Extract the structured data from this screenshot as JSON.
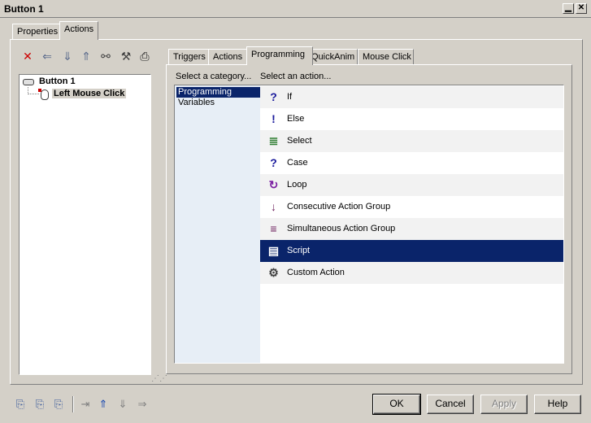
{
  "window": {
    "title": "Button 1"
  },
  "outer_tabs": [
    {
      "label": "Properties"
    },
    {
      "label": "Actions"
    }
  ],
  "left_toolbar": [
    {
      "icon": "delete-icon",
      "glyph": "✕",
      "color": "#cc0000"
    },
    {
      "icon": "arrow-left-icon",
      "glyph": "⇐",
      "color": "#5a6a8c"
    },
    {
      "icon": "arrow-down-icon",
      "glyph": "⇓",
      "color": "#5a6a8c"
    },
    {
      "icon": "arrow-up-icon",
      "glyph": "⇑",
      "color": "#5a6a8c"
    },
    {
      "icon": "find-icon",
      "glyph": "⚯",
      "color": "#404040"
    },
    {
      "icon": "tools-icon",
      "glyph": "⚒",
      "color": "#404040"
    },
    {
      "icon": "print-icon",
      "glyph": "⎙",
      "color": "#202020"
    }
  ],
  "tree": {
    "root": "Button 1",
    "child": "Left Mouse Click"
  },
  "inner_tabs": [
    {
      "label": "Triggers"
    },
    {
      "label": "Actions"
    },
    {
      "label": "Programming"
    },
    {
      "label": "QuickAnim"
    },
    {
      "label": "Mouse Click"
    }
  ],
  "headers": {
    "category": "Select a category...",
    "action": "Select an action..."
  },
  "categories": [
    {
      "label": "Programming",
      "selected": true
    },
    {
      "label": "Variables",
      "selected": false
    }
  ],
  "actions": [
    {
      "label": "If",
      "icon": "question-icon",
      "glyph": "?",
      "color": "#1a1a9c"
    },
    {
      "label": "Else",
      "icon": "exclamation-icon",
      "glyph": "!",
      "color": "#1a1a9c"
    },
    {
      "label": "Select",
      "icon": "select-icon",
      "glyph": "≣",
      "color": "#2e7d32"
    },
    {
      "label": "Case",
      "icon": "case-icon",
      "glyph": "?",
      "color": "#1a1a9c"
    },
    {
      "label": "Loop",
      "icon": "loop-icon",
      "glyph": "↻",
      "color": "#7b1fa2"
    },
    {
      "label": "Consecutive Action Group",
      "icon": "consecutive-group-icon",
      "glyph": "↓",
      "color": "#6a1b5a"
    },
    {
      "label": "Simultaneous Action Group",
      "icon": "simultaneous-group-icon",
      "glyph": "≡",
      "color": "#6a1b5a"
    },
    {
      "label": "Script",
      "icon": "script-icon",
      "glyph": "▤",
      "color": "#ffffff"
    },
    {
      "label": "Custom Action",
      "icon": "custom-action-icon",
      "glyph": "⚙",
      "color": "#404040"
    }
  ],
  "selected_action": "Script",
  "bottom_toolbar": [
    {
      "icon": "add-action-icon",
      "glyph": "⎘"
    },
    {
      "icon": "add-group-icon",
      "glyph": "⎘"
    },
    {
      "icon": "add-trigger-icon",
      "glyph": "⎘"
    },
    {
      "icon": "indent-icon",
      "glyph": "⇥"
    },
    {
      "icon": "move-up-icon",
      "glyph": "⇑"
    },
    {
      "icon": "move-down-icon",
      "glyph": "⇓"
    },
    {
      "icon": "move-right-icon",
      "glyph": "⇒"
    }
  ],
  "buttons": {
    "ok": "OK",
    "cancel": "Cancel",
    "apply": "Apply",
    "help": "Help"
  }
}
